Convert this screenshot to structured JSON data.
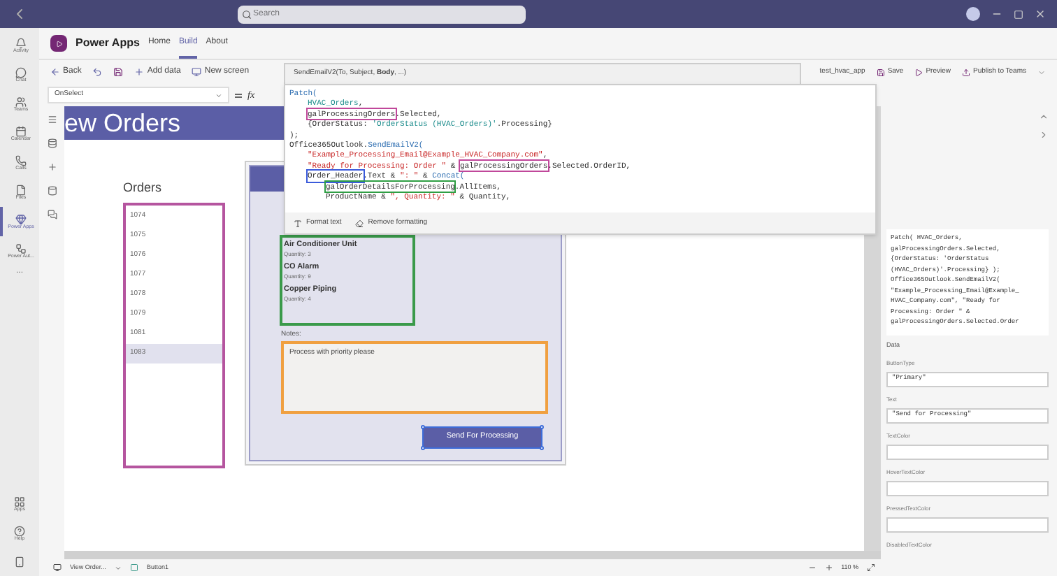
{
  "titlebar": {
    "search_placeholder": "Search"
  },
  "rail": {
    "items": [
      {
        "label": "Activity",
        "selected": false
      },
      {
        "label": "Chat",
        "selected": false
      },
      {
        "label": "Teams",
        "selected": false
      },
      {
        "label": "Calendar",
        "selected": false
      },
      {
        "label": "Calls",
        "selected": false
      },
      {
        "label": "Files",
        "selected": false
      },
      {
        "label": "Power Apps",
        "selected": true
      },
      {
        "label": "Power Aut...",
        "selected": false
      }
    ],
    "more": "...",
    "bottom": [
      "Apps",
      "Help"
    ]
  },
  "app_header": {
    "title": "Power Apps",
    "tabs": [
      {
        "label": "Home",
        "selected": false
      },
      {
        "label": "Build",
        "selected": true
      },
      {
        "label": "About",
        "selected": false
      }
    ]
  },
  "toolbar": {
    "left": [
      "Back",
      "Add data",
      "New screen"
    ],
    "app_name": "test_hvac_app",
    "right": [
      "Save",
      "Preview",
      "Publish to Teams"
    ]
  },
  "formula_bar": {
    "property": "OnSelect",
    "fx": "fx"
  },
  "screen": {
    "header": "ew Orders",
    "orders_label": "Orders",
    "orders": [
      {
        "id": "1074",
        "selected": false
      },
      {
        "id": "1075",
        "selected": false
      },
      {
        "id": "1076",
        "selected": false
      },
      {
        "id": "1077",
        "selected": false
      },
      {
        "id": "1078",
        "selected": false
      },
      {
        "id": "1079",
        "selected": false
      },
      {
        "id": "1081",
        "selected": false
      },
      {
        "id": "1083",
        "selected": true
      }
    ],
    "items": [
      {
        "name": "Air Conditioner Unit",
        "quantity": "Quantity: 3"
      },
      {
        "name": "CO Alarm",
        "quantity": "Quantity: 9"
      },
      {
        "name": "Copper Piping",
        "quantity": "Quantity: 4"
      }
    ],
    "notes_label": "Notes:",
    "notes_value": "Process with priority please",
    "button": "Send For Processing"
  },
  "formula_popup": {
    "signature": "SendEmailV2(To, Subject, **Body**, ...)",
    "lines": [
      {
        "segments": [
          {
            "kind": "fn",
            "text": "Patch("
          }
        ],
        "children": [
          {
            "segments": [
              {
                "kind": "table",
                "text": "HVAC_Orders"
              },
              {
                "kind": "plain",
                "text": ","
              }
            ]
          },
          {
            "segments": [
              {
                "kind": "ref",
                "color": "#c0479a",
                "text": "galProcessingOrders"
              },
              {
                "kind": "plain",
                "text": ".Selected,"
              }
            ]
          },
          {
            "segments": [
              {
                "kind": "plain",
                "text": "{OrderStatus: "
              },
              {
                "kind": "table",
                "text": "'OrderStatus (HVAC_Orders)'"
              },
              {
                "kind": "plain",
                "text": ".Processing}"
              }
            ]
          }
        ]
      },
      {
        "segments": [
          {
            "kind": "plain",
            "text": ");"
          }
        ]
      },
      {
        "segments": [
          {
            "kind": "plain",
            "text": "Office365Outlook."
          },
          {
            "kind": "fn",
            "text": "SendEmailV2("
          }
        ],
        "children": [
          {
            "segments": [
              {
                "kind": "string",
                "text": "\"Example_Processing_Email@Example_HVAC_Company.com\""
              },
              {
                "kind": "plain",
                "text": ","
              }
            ]
          },
          {
            "segments": [
              {
                "kind": "string",
                "text": "\"Ready for Processing: Order \""
              },
              {
                "kind": "plain",
                "text": " & "
              },
              {
                "kind": "ref",
                "color": "#c0479a",
                "text": "galProcessingOrders"
              },
              {
                "kind": "plain",
                "text": ".Selected.OrderID,"
              }
            ]
          },
          {
            "segments": [
              {
                "kind": "ref",
                "color": "#3b5bdb",
                "text": "Order_Header"
              },
              {
                "kind": "plain",
                "text": ".Text & "
              },
              {
                "kind": "string",
                "text": "\": \""
              },
              {
                "kind": "plain",
                "text": " & "
              },
              {
                "kind": "fn",
                "text": "Concat("
              }
            ],
            "children": [
              {
                "segments": [
                  {
                    "kind": "ref",
                    "color": "#2f9e44",
                    "text": "galOrderDetailsForProcessing"
                  },
                  {
                    "kind": "plain",
                    "text": ".AllItems,"
                  }
                ]
              },
              {
                "segments": [
                  {
                    "kind": "plain",
                    "text": "ProductName & "
                  },
                  {
                    "kind": "string",
                    "text": "\", Quantity: \""
                  },
                  {
                    "kind": "plain",
                    "text": " & Quantity,"
                  }
                ]
              }
            ]
          }
        ]
      }
    ],
    "actions": [
      "Format text",
      "Remove formatting"
    ]
  },
  "properties": {
    "code_lines": [
      "Patch( HVAC_Orders,",
      "galProcessingOrders.Selected,",
      "{OrderStatus: 'OrderStatus",
      "(HVAC_Orders)'.Processing} );",
      "Office365Outlook.SendEmailV2(",
      "\"Example_Processing_Email@Example_",
      "HVAC_Company.com\", \"Ready for",
      "Processing: Order \" &",
      "galProcessingOrders.Selected.Order"
    ],
    "section": "Data",
    "fields": [
      {
        "label": "ButtonType",
        "value": "\"Primary\""
      },
      {
        "label": "Text",
        "value": "\"Send for Processing\""
      },
      {
        "label": "TextColor"
      },
      {
        "label": "HoverTextColor"
      },
      {
        "label": "PressedTextColor"
      },
      {
        "label": "DisabledTextColor"
      }
    ]
  },
  "status_bar": {
    "screen": "View Order...",
    "control": "Button1",
    "zoom": "110 %"
  }
}
